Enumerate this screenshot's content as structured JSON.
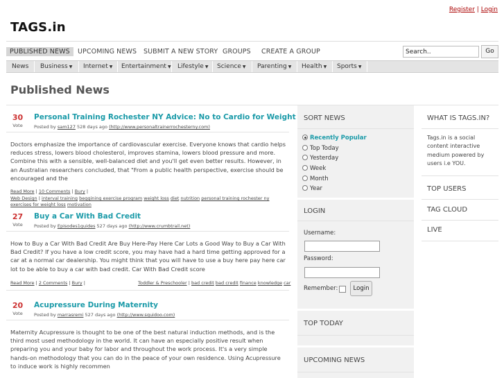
{
  "header": {
    "register": "Register",
    "separator": "|",
    "login": "Login",
    "logo": "TAGS.in"
  },
  "nav": {
    "items": [
      "PUBLISHED NEWS",
      "UPCOMING NEWS",
      "SUBMIT A NEW STORY",
      "GROUPS",
      "CREATE A GROUP"
    ],
    "search_value": "Search..",
    "go_label": "Go"
  },
  "categories": [
    "News",
    "Business",
    "Internet",
    "Entertainment",
    "Lifestyle",
    "Science",
    "Parenting",
    "Health",
    "Sports"
  ],
  "page_title": "Published News",
  "stories": [
    {
      "votes": "30",
      "vote_label": "Vote",
      "title": "Personal Training Rochester NY Advice: No to Cardio for Weight Loss",
      "posted_by": "Posted by",
      "user": "sam127",
      "age": "528 days ago",
      "url": "(http://www.personaltrainerrochesterny.com)",
      "body": "Doctors emphasize the importance of cardiovascular exercise. Everyone knows that cardio helps reduces stress, lowers blood cholesterol, improves stamina, lowers blood pressure and more. Combine this with a sensible, well-balanced diet and you'll get even better results. However, in an Australian researchers concluded, that \"From a public health perspective, exercise should be encouraged and the",
      "read_more": "Read More",
      "comments": "10 Comments",
      "bury": "Bury",
      "group": "Web Design",
      "tags": [
        "interval training",
        "beggining exercise program",
        "weight loss",
        "diet",
        "nutrition",
        "personal training rochester ny",
        "exercises for weight loss",
        "motivation"
      ]
    },
    {
      "votes": "27",
      "vote_label": "Vote",
      "title": "Buy a Car With Bad Credit",
      "posted_by": "Posted by",
      "user": "Episodes1guides",
      "age": "527 days ago",
      "url": "(http://www.crumbtrail.net)",
      "body": "How to Buy a Car With Bad Credit Are Buy Here-Pay Here Car Lots a Good Way to Buy a Car With Bad Credit? If you have a low credit score, you may have had a hard time getting approved for a car at a normal car dealership. You might think that you will have to use a buy here pay here car lot to be able to buy a car with bad credit. Car With Bad Credit score",
      "read_more": "Read More",
      "comments": "2 Comments",
      "bury": "Bury",
      "group": "Toddler & Preschooler",
      "tags": [
        "bad credit",
        "bad credit",
        "finance",
        "knowledge",
        "car"
      ]
    },
    {
      "votes": "20",
      "vote_label": "Vote",
      "title": "Acupressure During Maternity",
      "posted_by": "Posted by",
      "user": "marrasremi",
      "age": "527 days ago",
      "url": "(http://www.squidoo.com)",
      "body": "Maternity Acupressure is thought to be one of the best natural induction methods, and is the third most used methodology in the world. It can have an especially positive result when preparing you and your baby for labor and throughout the work process. It's a very simple hands-on methodology that you can do in the peace of your own residence. Using Acupressure to induce work is highly recommen"
    }
  ],
  "sort_news": {
    "title": "SORT NEWS",
    "options": [
      "Recently Popular",
      "Top Today",
      "Yesterday",
      "Week",
      "Month",
      "Year"
    ],
    "selected": "Recently Popular"
  },
  "login_box": {
    "title": "LOGIN",
    "username_label": "Username:",
    "password_label": "Password:",
    "remember_label": "Remember:",
    "button": "Login"
  },
  "top_today": "TOP TODAY",
  "upcoming_news": "UPCOMING NEWS",
  "sidebar": {
    "what_is": "WHAT IS TAGS.IN?",
    "about": "Tags.in is a social content interactive medium powered by users i.e YOU.",
    "top_users": "TOP USERS",
    "tag_cloud": "TAG CLOUD",
    "live": "LIVE"
  },
  "colors": {
    "accent": "#1a9aa8",
    "votes": "#cc3333",
    "top_links": "#aa0000"
  }
}
